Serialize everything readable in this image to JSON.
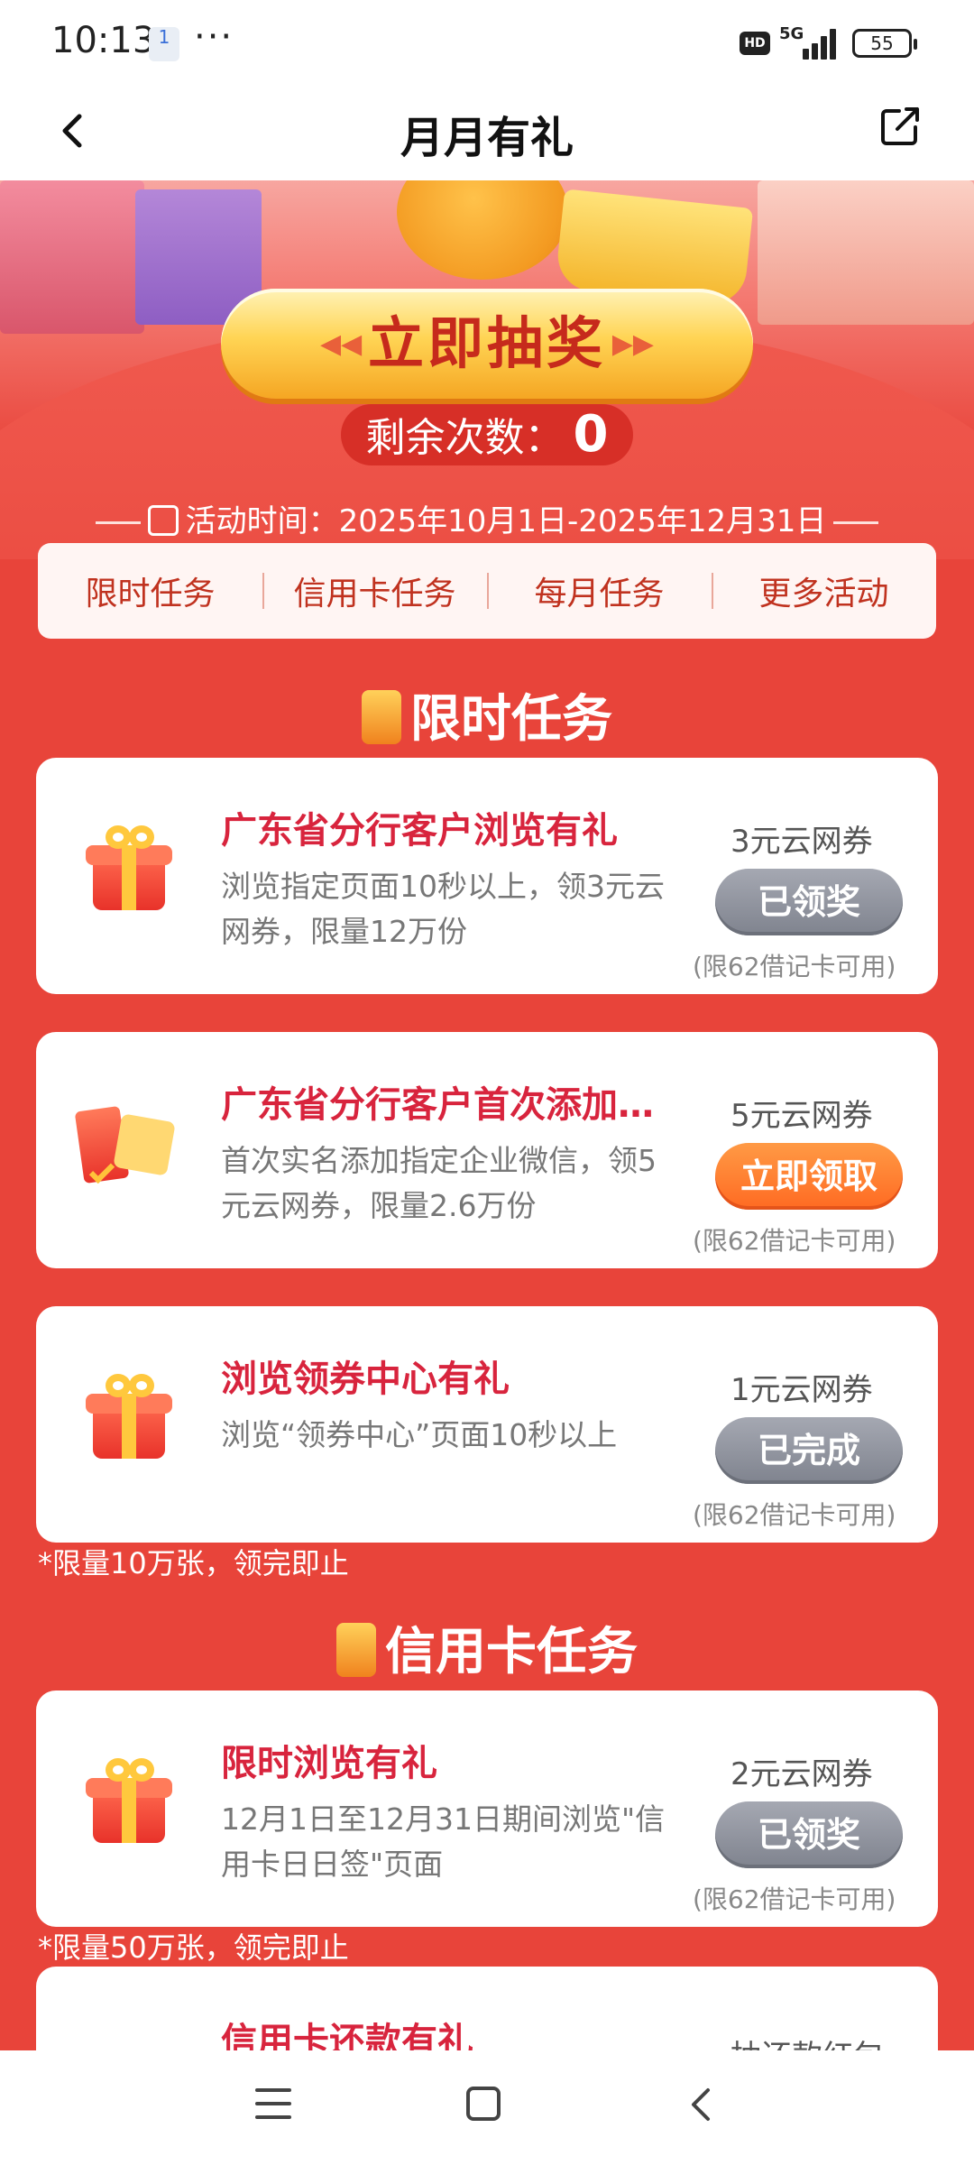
{
  "status_bar": {
    "time": "10:13",
    "sim_badge": "1",
    "overflow": "···",
    "hd": "HD",
    "network": "5G",
    "battery": "55"
  },
  "header": {
    "title": "月月有礼",
    "back_icon": "back-arrow-icon",
    "share_icon": "share-external-icon"
  },
  "hero": {
    "draw_button": "立即抽奖",
    "remaining_label": "剩余次数：",
    "remaining_count": "0",
    "period": "活动时间：2025年10月1日-2025年12月31日"
  },
  "tabs": [
    "限时任务",
    "信用卡任务",
    "每月任务",
    "更多活动"
  ],
  "sections": {
    "limited": {
      "title": "限时任务",
      "note": "*限量10万张，领完即止"
    },
    "credit": {
      "title": "信用卡任务",
      "note": "*限量50万张，领完即止"
    }
  },
  "tasks": [
    {
      "title": "广东省分行客户浏览有礼",
      "desc": "浏览指定页面10秒以上，领3元云网券，限量12万份",
      "reward": "3元云网券",
      "button": "已领奖",
      "button_state": "disabled",
      "limit": "(限62借记卡可用)"
    },
    {
      "title": "广东省分行客户首次添加…",
      "desc": "首次实名添加指定企业微信，领5元云网券，限量2.6万份",
      "reward": "5元云网券",
      "button": "立即领取",
      "button_state": "active",
      "limit": "(限62借记卡可用)"
    },
    {
      "title": "浏览领券中心有礼",
      "desc": "浏览“领券中心”页面10秒以上",
      "reward": "1元云网券",
      "button": "已完成",
      "button_state": "disabled",
      "limit": "(限62借记卡可用)"
    },
    {
      "title": "限时浏览有礼",
      "desc": "12月1日至12月31日期间浏览\"信用卡日日签\"页面",
      "reward": "2元云网券",
      "button": "已领奖",
      "button_state": "disabled",
      "limit": "(限62借记卡可用)"
    },
    {
      "title": "信用卡还款有礼",
      "desc": "",
      "reward": "抽还款红包",
      "button": "",
      "button_state": "",
      "limit": ""
    }
  ],
  "colors": {
    "page_bg": "#e8443a",
    "title_red": "#d8243d",
    "orange_button": "#ff6a22",
    "grey_button": "#7f838e"
  },
  "nav_bar": {
    "menu_icon": "menu-icon",
    "home_icon": "home-square-icon",
    "back_icon": "nav-back-icon"
  }
}
